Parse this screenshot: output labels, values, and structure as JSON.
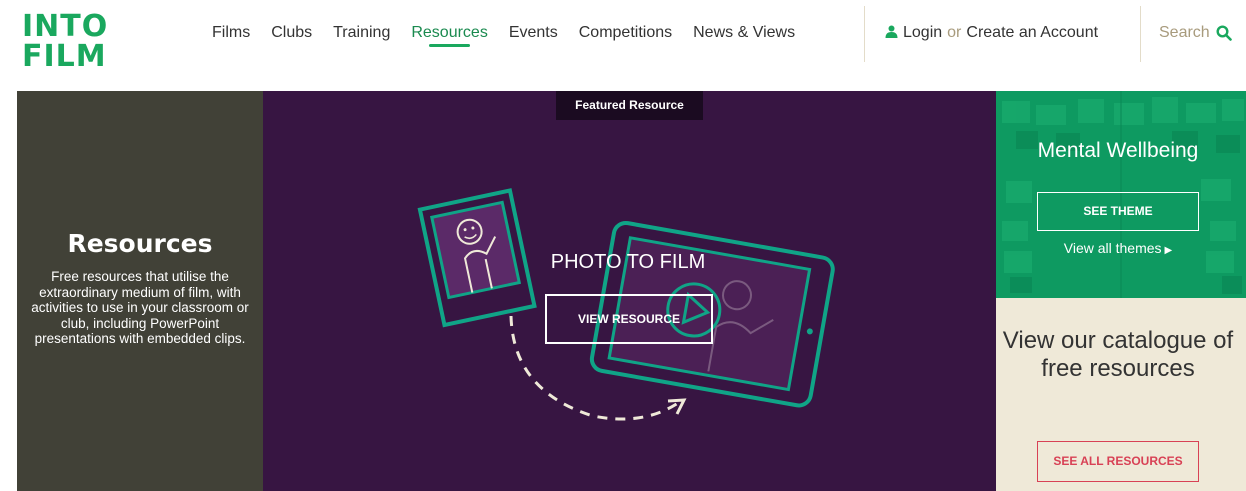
{
  "logo": {
    "line1": "INTO",
    "line2": "FILM"
  },
  "nav": {
    "items": [
      {
        "label": "Films"
      },
      {
        "label": "Clubs"
      },
      {
        "label": "Training"
      },
      {
        "label": "Resources"
      },
      {
        "label": "Events"
      },
      {
        "label": "Competitions"
      },
      {
        "label": "News & Views"
      }
    ],
    "active": "Resources"
  },
  "account": {
    "login": "Login",
    "or": "or",
    "create": "Create an Account",
    "icon": "user-icon"
  },
  "search": {
    "label": "Search",
    "icon": "search-icon"
  },
  "intro": {
    "title": "Resources",
    "description": "Free resources that utilise the extraordinary medium of film, with activities to use in your classroom or club, including PowerPoint presentations with embedded clips."
  },
  "featured": {
    "tag": "Featured Resource",
    "title": "PHOTO TO FILM",
    "button": "VIEW RESOURCE"
  },
  "theme": {
    "title": "Mental Wellbeing",
    "button": "SEE THEME",
    "link": "View all themes",
    "link_icon": "triangle-right-icon"
  },
  "catalogue": {
    "text": "View our catalogue of free resources",
    "button": "SEE ALL RESOURCES"
  },
  "colors": {
    "brand_green": "#1aa85e",
    "featured_bg": "#371542",
    "intro_bg": "#414137",
    "theme_bg": "#0e9a61",
    "catalogue_bg": "#efe9d8",
    "accent_red": "#d84155"
  }
}
